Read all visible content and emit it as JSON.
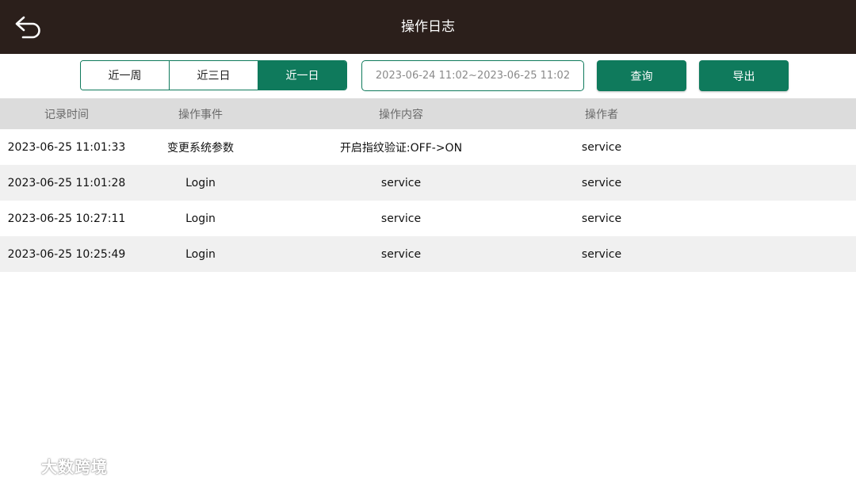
{
  "header": {
    "title": "操作日志",
    "back_icon": "back-arrow-icon"
  },
  "filters": {
    "periods": [
      {
        "label": "近一周",
        "active": false
      },
      {
        "label": "近三日",
        "active": false
      },
      {
        "label": "近一日",
        "active": true
      }
    ],
    "date_range": "2023-06-24 11:02~2023-06-25 11:02",
    "query_label": "查询",
    "export_label": "导出"
  },
  "table": {
    "columns": [
      "记录时间",
      "操作事件",
      "操作内容",
      "操作者"
    ],
    "rows": [
      [
        "2023-06-25 11:01:33",
        "变更系统参数",
        "开启指纹验证:OFF->ON",
        "service"
      ],
      [
        "2023-06-25 11:01:28",
        "Login",
        "service",
        "service"
      ],
      [
        "2023-06-25 10:27:11",
        "Login",
        "service",
        "service"
      ],
      [
        "2023-06-25 10:25:49",
        "Login",
        "service",
        "service"
      ]
    ]
  },
  "watermark": {
    "text": "大数跨境"
  },
  "colors": {
    "header_bg": "#2b1f1b",
    "accent": "#0f7a5c",
    "table_header_bg": "#dcdcdc",
    "row_alt_bg": "#f0f0f0"
  }
}
